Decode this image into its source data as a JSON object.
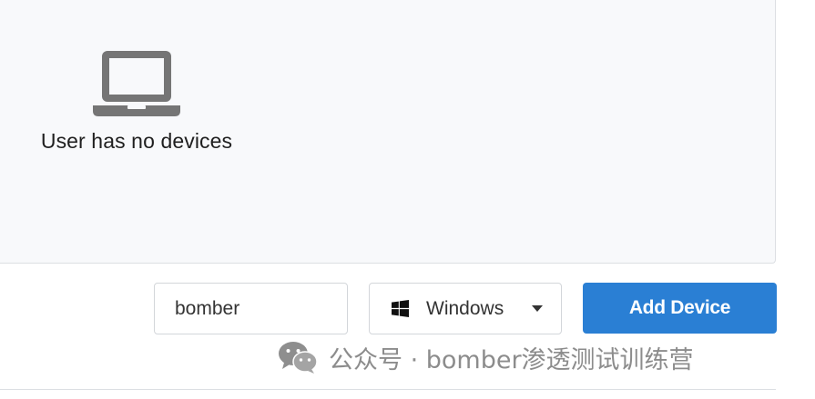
{
  "devices": {
    "empty_message": "User has no devices",
    "empty_icon": "laptop-icon"
  },
  "add_form": {
    "username_value": "bomber",
    "os_select": {
      "selected": "Windows",
      "icon": "windows-icon"
    },
    "add_button_label": "Add Device"
  },
  "watermark": {
    "text": "公众号 · bomber渗透测试训练营",
    "icon": "wechat-icon"
  },
  "colors": {
    "primary_button": "#2a7fd4",
    "panel_background": "#f8f9fb",
    "icon_gray": "#757575"
  }
}
